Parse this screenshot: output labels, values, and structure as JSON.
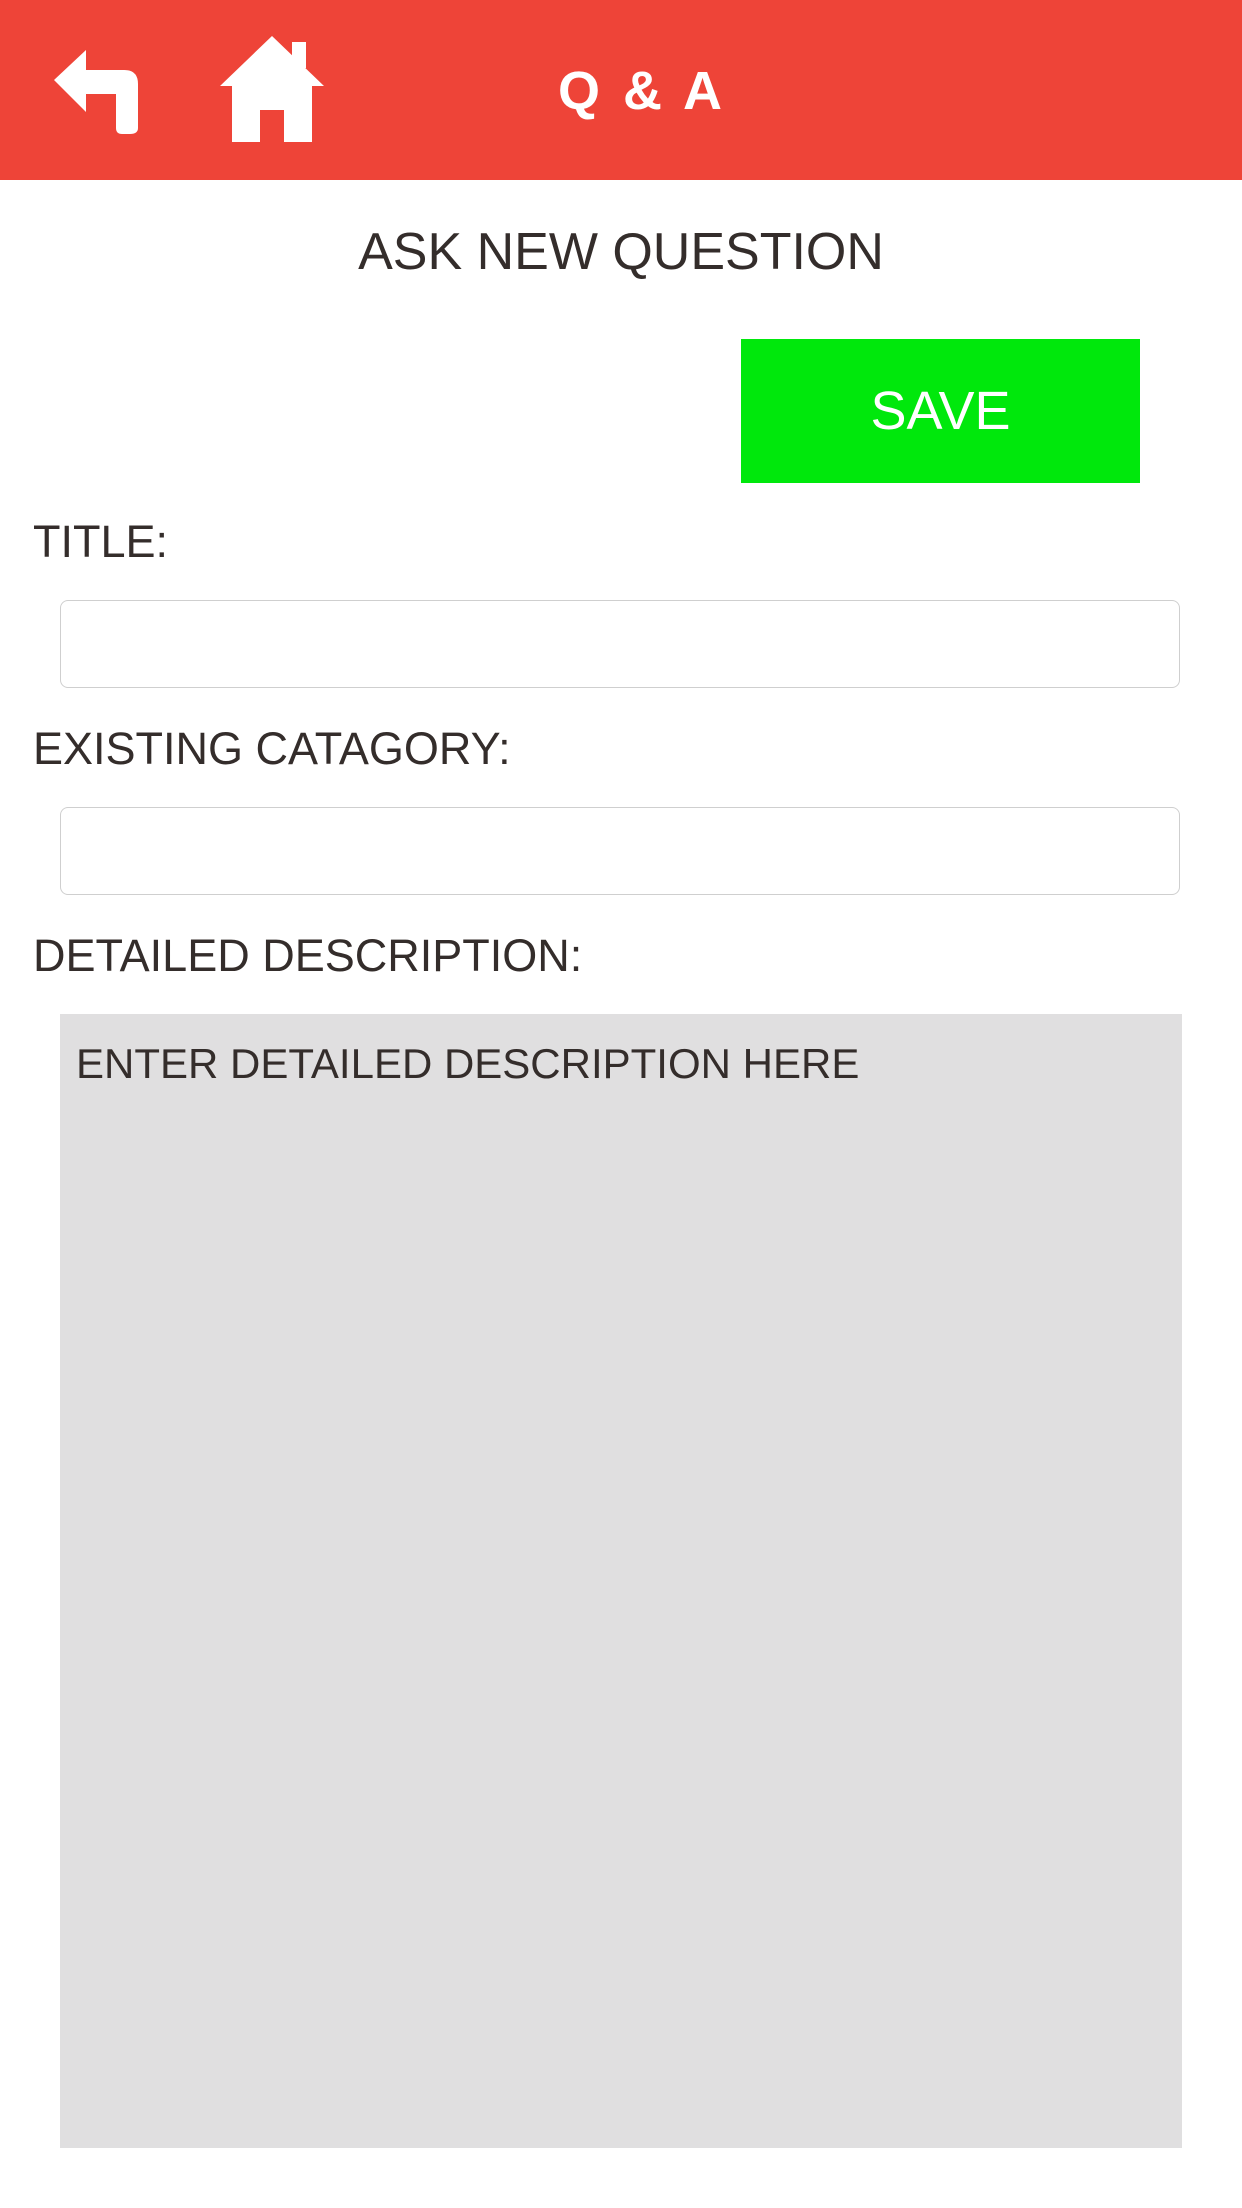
{
  "header": {
    "title": "Q & A",
    "back_icon": "back-arrow-icon",
    "home_icon": "home-icon",
    "color": "#ee4438"
  },
  "page": {
    "heading": "ASK NEW QUESTION"
  },
  "save_button": {
    "label": "SAVE",
    "color": "#00e80c"
  },
  "form": {
    "title_label": "TITLE:",
    "title_value": "",
    "category_label": "EXISTING CATAGORY:",
    "category_value": "",
    "description_label": "DETAILED DESCRIPTION:",
    "description_placeholder": "ENTER DETAILED DESCRIPTION HERE"
  }
}
